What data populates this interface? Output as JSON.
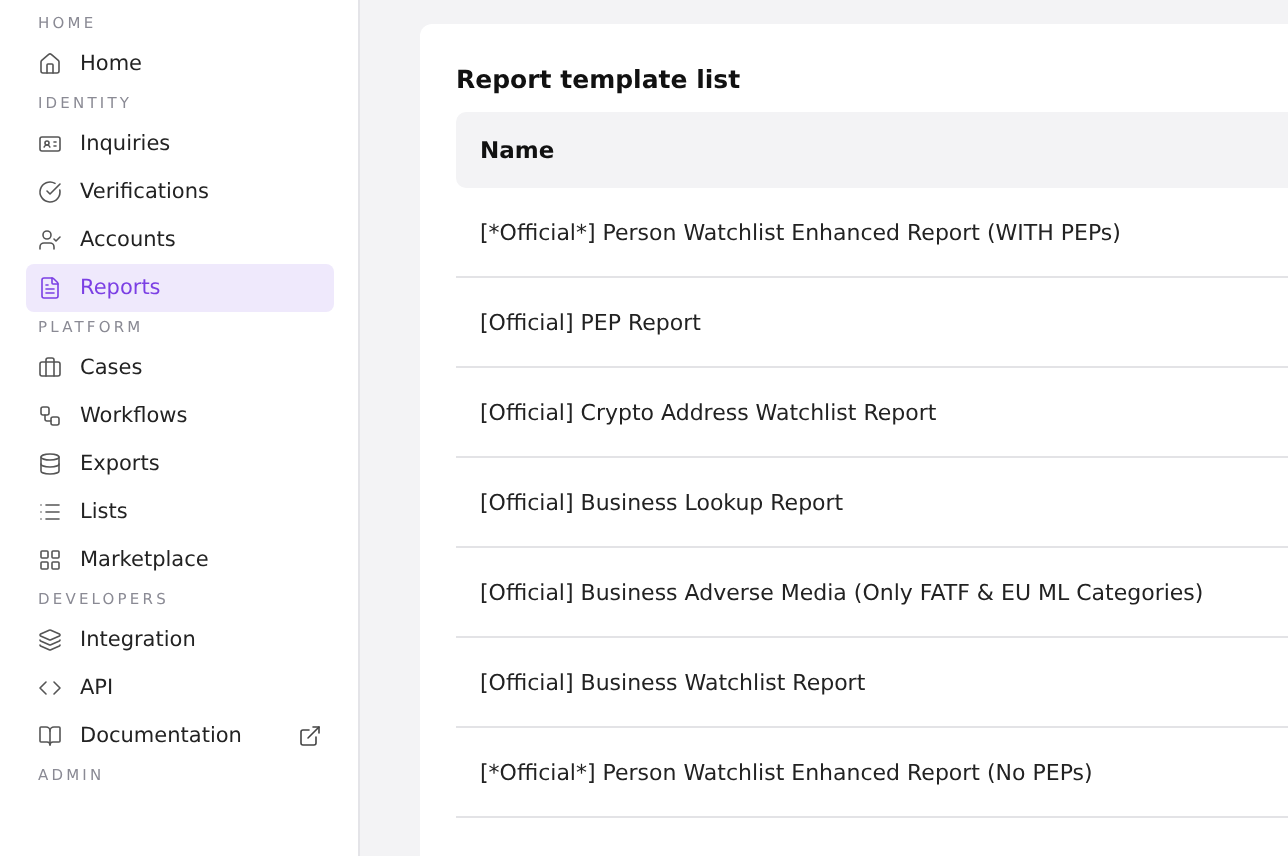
{
  "sidebar": {
    "sections": [
      {
        "label": "HOME",
        "items": [
          {
            "label": "Home",
            "selected": false
          }
        ]
      },
      {
        "label": "IDENTITY",
        "items": [
          {
            "label": "Inquiries",
            "selected": false
          },
          {
            "label": "Verifications",
            "selected": false
          },
          {
            "label": "Accounts",
            "selected": false
          },
          {
            "label": "Reports",
            "selected": true
          }
        ]
      },
      {
        "label": "PLATFORM",
        "items": [
          {
            "label": "Cases",
            "selected": false
          },
          {
            "label": "Workflows",
            "selected": false
          },
          {
            "label": "Exports",
            "selected": false
          },
          {
            "label": "Lists",
            "selected": false
          },
          {
            "label": "Marketplace",
            "selected": false
          }
        ]
      },
      {
        "label": "DEVELOPERS",
        "items": [
          {
            "label": "Integration",
            "selected": false
          },
          {
            "label": "API",
            "selected": false
          },
          {
            "label": "Documentation",
            "selected": false,
            "external": true
          }
        ]
      },
      {
        "label": "ADMIN"
      }
    ]
  },
  "card": {
    "title": "Report template list",
    "table": {
      "columns": [
        "Name"
      ],
      "rows": [
        "[*Official*] Person Watchlist Enhanced Report (WITH PEPs)",
        "[Official] PEP Report",
        "[Official] Crypto Address Watchlist Report",
        "[Official] Business Lookup Report",
        "[Official] Business Adverse Media (Only FATF & EU ML Categories)",
        "[Official] Business Watchlist Report",
        "[*Official*] Person Watchlist Enhanced Report (No PEPs)"
      ]
    }
  }
}
